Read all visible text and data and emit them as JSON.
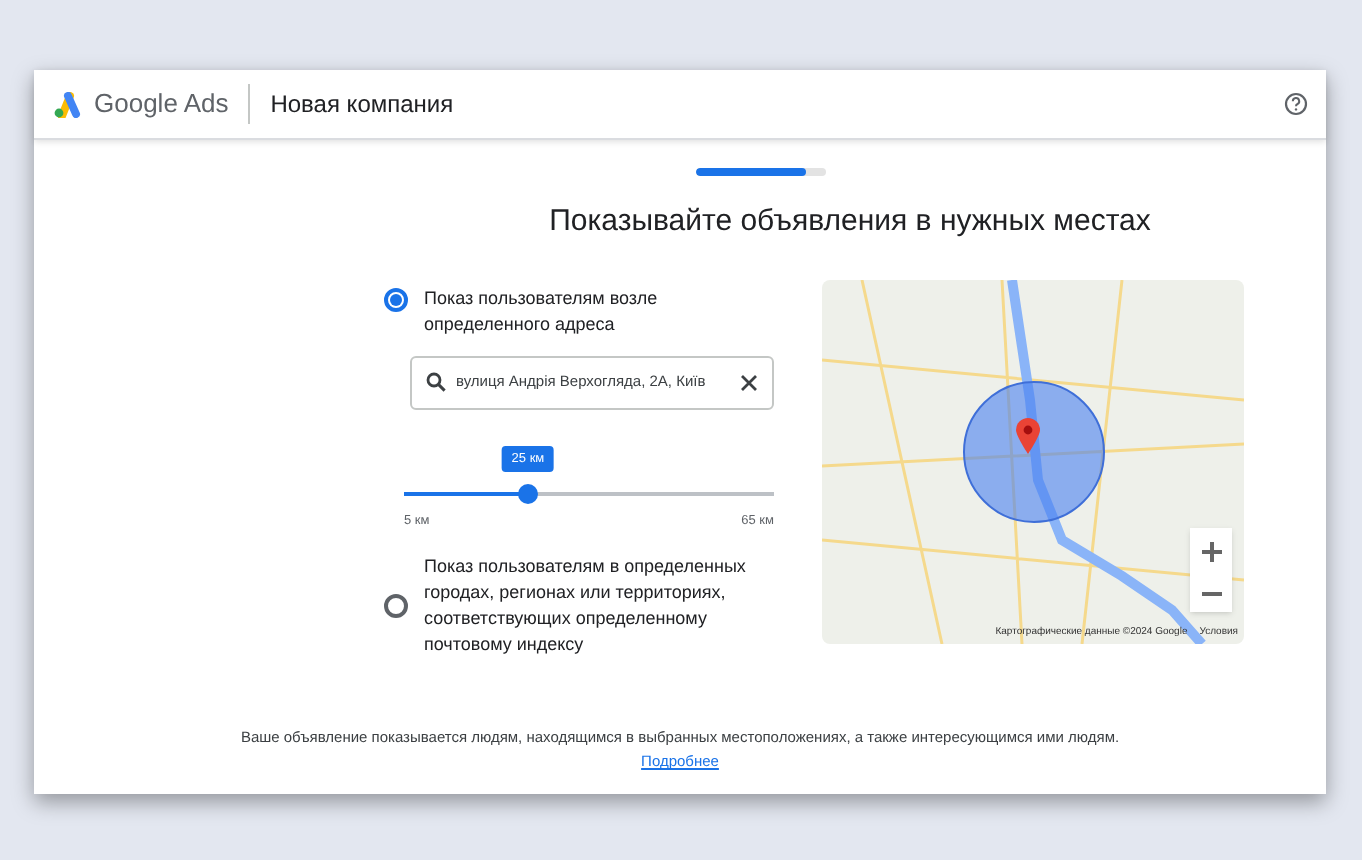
{
  "header": {
    "product": "Google Ads",
    "title": "Новая компания"
  },
  "progress": {
    "level": 0.85
  },
  "heading": "Показывайте объявления в нужных местах",
  "options": [
    {
      "kind": "address",
      "label": "Показ пользователям возле определенного адреса",
      "selected": true
    },
    {
      "kind": "regions",
      "label": "Показ пользователям в определенных городах, регионах или территориях, соответствующих определенному почтовому индексу",
      "selected": false
    }
  ],
  "search": {
    "value": "вулиця Андрія Верхогляда, 2А, Київ"
  },
  "radius": {
    "level": 0.335,
    "reading": "25 км",
    "min": "5 км",
    "max": "65 км"
  },
  "map": {
    "attribution": "Картографические данные ©2024 Google",
    "terms": "Условия"
  },
  "footer": {
    "text": "Ваше объявление показывается людям, находящимся в выбранных местоположениях, а также интересующимся ими людям.",
    "link": "Подробнее"
  }
}
